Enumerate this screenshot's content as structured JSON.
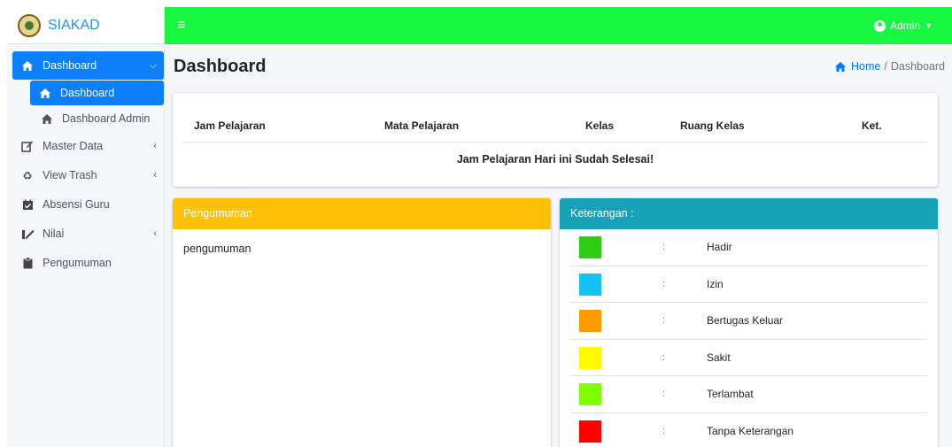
{
  "brand": {
    "name": "SIAKAD"
  },
  "sidebar": {
    "items": [
      {
        "label": "Dashboard",
        "icon": "home-icon",
        "active": true,
        "chevron": "down"
      },
      {
        "label": "Dashboard",
        "icon": "home-icon",
        "active": true,
        "sub": true
      },
      {
        "label": "Dashboard Admin",
        "icon": "home-icon",
        "sub": true
      },
      {
        "label": "Master Data",
        "icon": "edit-icon",
        "chevron": "left"
      },
      {
        "label": "View Trash",
        "icon": "recycle-icon",
        "chevron": "left"
      },
      {
        "label": "Absensi Guru",
        "icon": "calendar-check-icon"
      },
      {
        "label": "Nilai",
        "icon": "signature-icon",
        "chevron": "left"
      },
      {
        "label": "Pengumuman",
        "icon": "clipboard-icon"
      }
    ]
  },
  "topbar": {
    "menu_icon": "hamburger-icon",
    "user_label": "Admin",
    "user_icon": "user-circle-icon",
    "color": "#18f740"
  },
  "page": {
    "title": "Dashboard"
  },
  "breadcrumb": {
    "home": "Home",
    "separator": "/",
    "current": "Dashboard"
  },
  "schedule": {
    "columns": [
      "Jam Pelajaran",
      "Mata Pelajaran",
      "Kelas",
      "Ruang Kelas",
      "Ket."
    ],
    "message": "Jam Pelajaran Hari ini Sudah Selesai!"
  },
  "pengumuman": {
    "title": "Pengumuman",
    "body": "pengumuman",
    "color": "#ffc107"
  },
  "keterangan": {
    "title": "Keterangan :",
    "color": "#17a2b8",
    "separator": ":",
    "items": [
      {
        "label": "Hadir",
        "color": "#2ecc14"
      },
      {
        "label": "Izin",
        "color": "#15c2f5"
      },
      {
        "label": "Bertugas Keluar",
        "color": "#ff9a00"
      },
      {
        "label": "Sakit",
        "color": "#fff800"
      },
      {
        "label": "Terlambat",
        "color": "#80ff00"
      },
      {
        "label": "Tanpa Keterangan",
        "color": "#ff0000"
      }
    ]
  }
}
